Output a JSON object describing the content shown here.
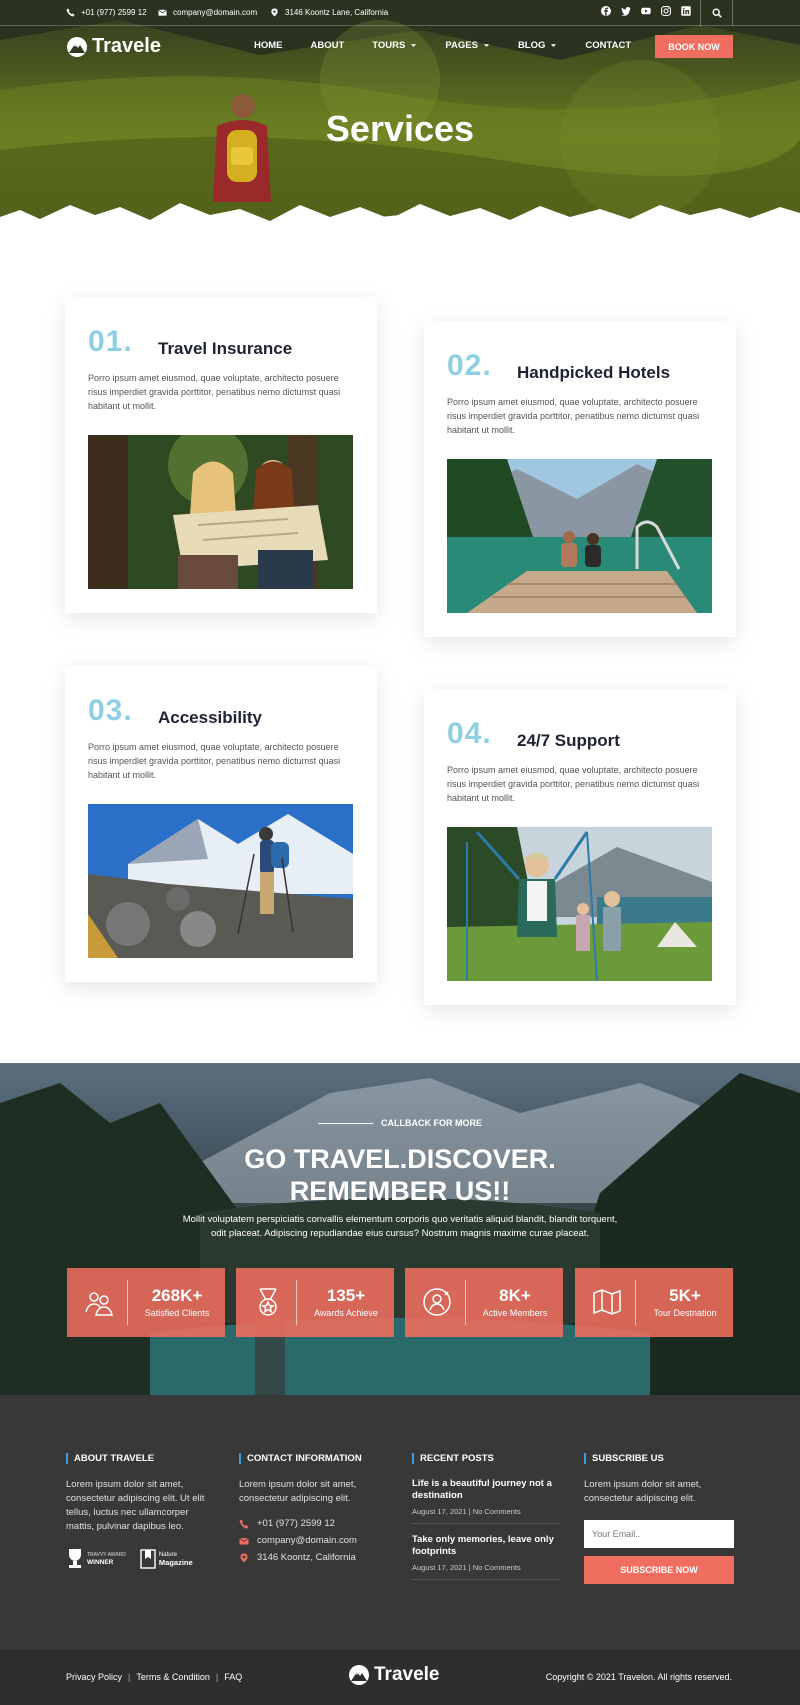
{
  "topbar": {
    "phone": "+01 (977) 2599 12",
    "email": "company@domain.com",
    "address": "3146 Koontz Lane, California",
    "social_icons": [
      "facebook-icon",
      "twitter-icon",
      "youtube-icon",
      "instagram-icon",
      "linkedin-icon"
    ],
    "search_icon": "search-icon"
  },
  "header": {
    "logo": "Travele",
    "nav": [
      {
        "label": "HOME",
        "dropdown": false
      },
      {
        "label": "ABOUT",
        "dropdown": false
      },
      {
        "label": "TOURS",
        "dropdown": true
      },
      {
        "label": "PAGES",
        "dropdown": true
      },
      {
        "label": "BLOG",
        "dropdown": true
      },
      {
        "label": "CONTACT",
        "dropdown": false
      }
    ],
    "book_now": "BOOK NOW"
  },
  "hero": {
    "title": "Services"
  },
  "services": [
    {
      "num": "01.",
      "title": "Travel Insurance",
      "desc": "Porro ipsum amet eiusmod, quae voluptate, architecto posuere risus imperdiet gravida porttitor, penatibus nemo dictumst quasi habitant ut mollit."
    },
    {
      "num": "02.",
      "title": "Handpicked Hotels",
      "desc": "Porro ipsum amet eiusmod, quae voluptate, architecto posuere risus imperdiet gravida porttitor, penatibus nemo dictumst quasi habitant ut mollit."
    },
    {
      "num": "03.",
      "title": "Accessibility",
      "desc": "Porro ipsum amet eiusmod, quae voluptate, architecto posuere risus imperdiet gravida porttitor, penatibus nemo dictumst quasi habitant ut mollit."
    },
    {
      "num": "04.",
      "title": "24/7 Support",
      "desc": "Porro ipsum amet eiusmod, quae voluptate, architecto posuere risus imperdiet gravida porttitor, penatibus nemo dictumst quasi habitant ut mollit."
    }
  ],
  "cta": {
    "pretitle": "CALLBACK FOR MORE",
    "title_line1": "GO TRAVEL.DISCOVER.",
    "title_line2": "REMEMBER US!!",
    "subtitle": "Mollit voluptatem perspiciatis convallis elementum corporis quo veritatis aliquid blandit, blandit torquent, odit placeat. Adipiscing repudiandae eius cursus? Nostrum magnis maxime curae placeat.",
    "stats": [
      {
        "value": "268K+",
        "label": "Satisfied Clients",
        "icon": "clients-icon"
      },
      {
        "value": "135+",
        "label": "Awards Achieve",
        "icon": "medal-icon"
      },
      {
        "value": "8K+",
        "label": "Active Members",
        "icon": "member-icon"
      },
      {
        "value": "5K+",
        "label": "Tour Destnation",
        "icon": "map-icon"
      }
    ]
  },
  "footer": {
    "about": {
      "heading": "ABOUT TRAVELE",
      "text": "Lorem ipsum dolor sit amet, consectetur adipiscing elit. Ut elit tellus, luctus nec ullamcorper mattis, pulvinar dapibus leo.",
      "badge1_top": "TRAVVY AWARD",
      "badge1_main": "WINNER",
      "badge2_top": "Nature",
      "badge2_main": "Magazine"
    },
    "contact": {
      "heading": "CONTACT INFORMATION",
      "text": "Lorem ipsum dolor sit amet, consectetur adipiscing elit.",
      "phone": "+01 (977) 2599 12",
      "email": "company@domain.com",
      "address": "3146 Koontz, California"
    },
    "posts": {
      "heading": "RECENT POSTS",
      "items": [
        {
          "title": "Life is a beautiful journey not a destination",
          "date": "August 17, 2021",
          "comments": "No Comments"
        },
        {
          "title": "Take only memories, leave only footprints",
          "date": "August 17, 2021",
          "comments": "No Comments"
        }
      ]
    },
    "subscribe": {
      "heading": "SUBSCRIBE US",
      "text": "Lorem ipsum dolor sit amet, consectetur adipiscing elit.",
      "placeholder": "Your Email..",
      "button": "SUBSCRIBE NOW"
    }
  },
  "bottom": {
    "links": [
      "Privacy Policy",
      "Terms & Condition",
      "FAQ"
    ],
    "logo": "Travele",
    "copyright": "Copyright © 2021 Travelon. All rights reserved."
  },
  "colors": {
    "accent": "#ef6e5f",
    "number": "#8ecfe3",
    "heading": "#1e2233",
    "footer_bg": "#383838"
  }
}
